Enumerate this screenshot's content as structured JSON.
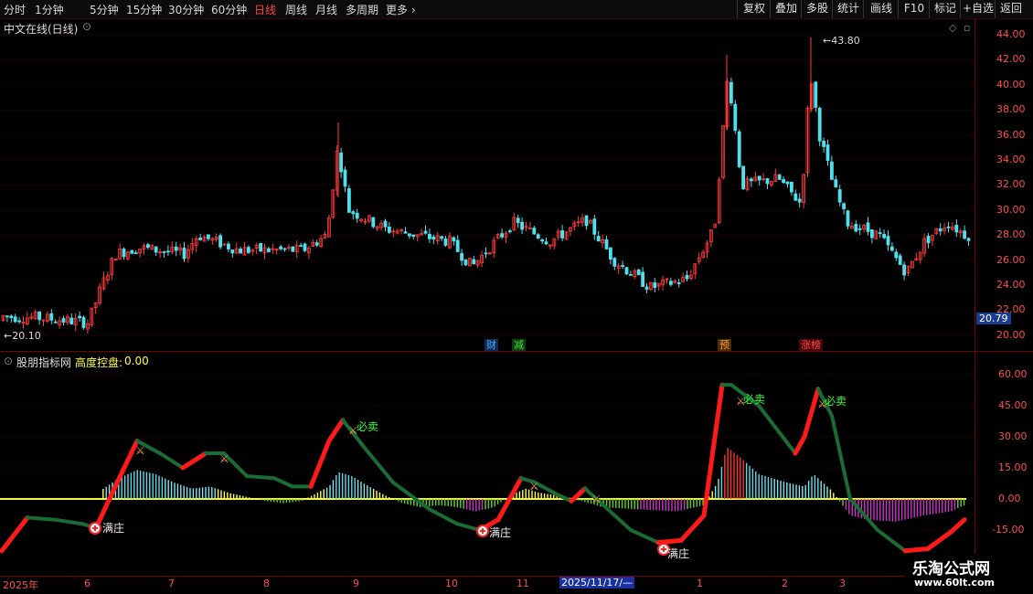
{
  "toolbar": {
    "periods": [
      "分时",
      "1分钟",
      "5分钟",
      "15分钟",
      "30分钟",
      "60分钟",
      "日线",
      "周线",
      "月线",
      "多周期"
    ],
    "more_label": "更多",
    "active_period": "日线",
    "actions": [
      "复权",
      "叠加",
      "多股",
      "统计",
      "画线",
      "F10",
      "标记",
      "+自选",
      "返回"
    ]
  },
  "main_panel": {
    "title": "中文在线(日线)",
    "price_labels": [
      "44.00",
      "42.00",
      "40.00",
      "38.00",
      "36.00",
      "34.00",
      "32.00",
      "30.00",
      "28.00",
      "26.00",
      "24.00",
      "22.00",
      "20.00"
    ],
    "current_price": "20.79",
    "high_marker": "43.80",
    "low_marker": "20.10",
    "event_badges": [
      {
        "text": "财",
        "color": "#4fa8ff"
      },
      {
        "text": "减",
        "color": "#44dd44"
      },
      {
        "text": "预",
        "color": "#ff9a3c"
      },
      {
        "text": "涨榜",
        "color": "#ff4d4d"
      }
    ],
    "colors": {
      "up": "#ff3b3b",
      "down": "#4fe0ee",
      "grid": "#5a0000"
    }
  },
  "indicator_panel": {
    "name": "股朋指标网",
    "indicator": "高度控盘:",
    "value": "0.00",
    "axis_labels": [
      "60.00",
      "45.00",
      "30.00",
      "15.00",
      "0.00",
      "-15.00"
    ],
    "annotations": {
      "sell": "必卖",
      "bottom": "满庄"
    },
    "colors": {
      "rise": "#ff1a1a",
      "fall": "#1a6b35",
      "zero": "#ffff00"
    }
  },
  "x_axis": {
    "labels": [
      "2025年",
      "6",
      "7",
      "8",
      "9",
      "10",
      "11",
      "2025/11/17/—",
      "1",
      "2",
      "3"
    ]
  },
  "watermark": {
    "title": "乐淘公式网",
    "url": "www.60lt.com"
  }
}
